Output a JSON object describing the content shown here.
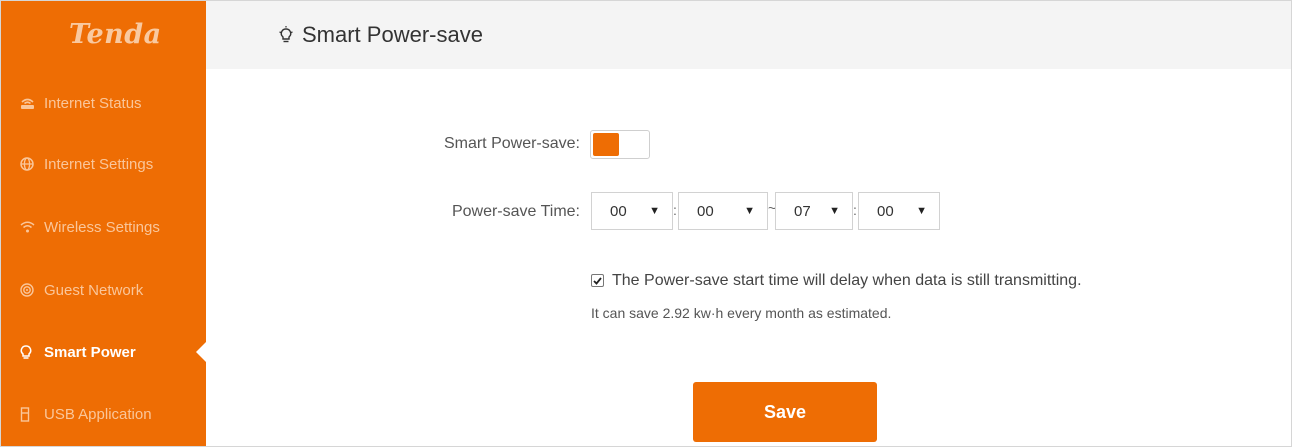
{
  "brand": {
    "logo_text": "Tenda",
    "accent_color": "#ee6d04"
  },
  "sidebar": {
    "items": [
      {
        "label": "Internet Status",
        "icon": "router-icon",
        "active": false
      },
      {
        "label": "Internet Settings",
        "icon": "globe-icon",
        "active": false
      },
      {
        "label": "Wireless Settings",
        "icon": "wifi-icon",
        "active": false
      },
      {
        "label": "Guest Network",
        "icon": "guest-network-icon",
        "active": false
      },
      {
        "label": "Smart Power",
        "icon": "bulb-icon",
        "active": true
      },
      {
        "label": "USB Application",
        "icon": "usb-icon",
        "active": false
      }
    ]
  },
  "header": {
    "title": "Smart Power-save",
    "icon": "bulb-icon"
  },
  "form": {
    "smart_power_save": {
      "label": "Smart Power-save:",
      "enabled": true
    },
    "power_save_time": {
      "label": "Power-save Time:",
      "start_hour": "00",
      "start_minute": "00",
      "range_separator": "~",
      "end_hour": "07",
      "end_minute": "00",
      "colon": ":"
    },
    "delay_option": {
      "checked": true,
      "text": "The Power-save start time will delay when data is still transmitting."
    },
    "estimate_text": "It can save 2.92 kw·h every month as estimated.",
    "save_label": "Save"
  }
}
